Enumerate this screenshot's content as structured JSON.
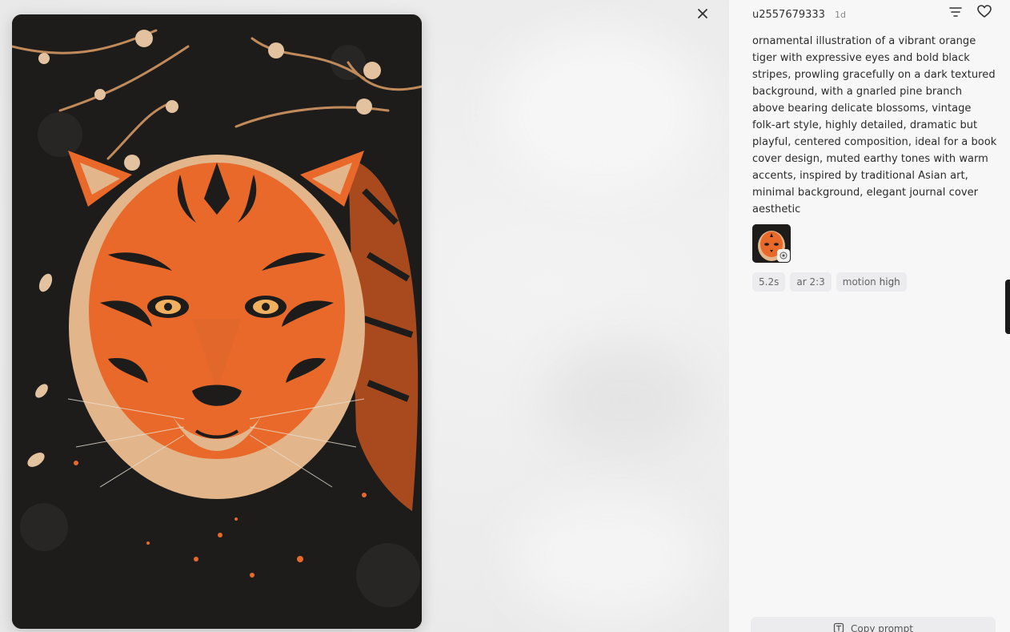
{
  "header": {
    "username": "u2557679333",
    "time_ago": "1d"
  },
  "prompt": {
    "text": "ornamental illustration of a vibrant orange tiger with expressive eyes and bold black stripes, prowling gracefully on a dark textured background, with a gnarled pine branch above bearing delicate blossoms, vintage folk-art style, highly detailed, dramatic but playful, centered composition, ideal for a book cover design, muted earthy tones with warm accents, inspired by traditional Asian art, minimal background, elegant journal cover aesthetic"
  },
  "tags": [
    {
      "label": "5.2s"
    },
    {
      "label": "ar 2:3"
    },
    {
      "key": "motion",
      "value": "high"
    }
  ],
  "actions": {
    "copy_prompt": "Copy prompt"
  },
  "icons": {
    "close": "close-icon",
    "menu": "filter-lines-icon",
    "like": "heart-icon",
    "copy": "copy-text-icon",
    "badge": "video-badge-icon"
  },
  "colors": {
    "panel_bg": "#f7f7f8",
    "tag_bg": "#ececee",
    "tiger_orange": "#e8692a",
    "artwork_bg": "#1c1b1a"
  }
}
